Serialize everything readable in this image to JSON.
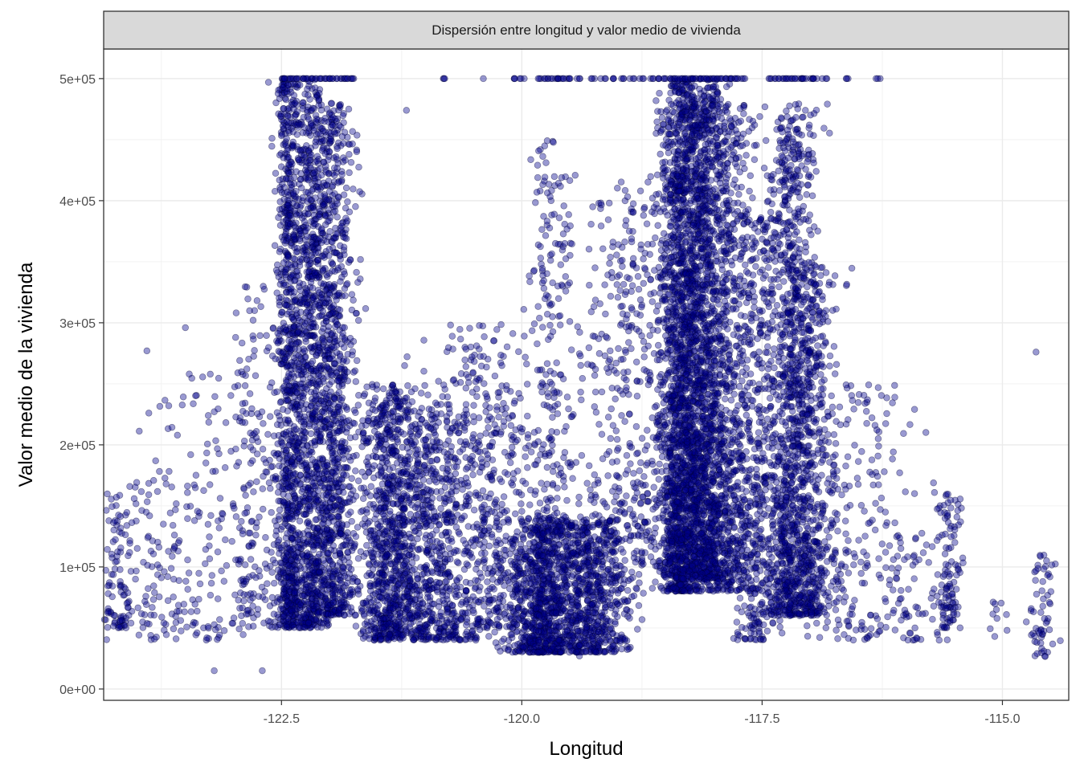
{
  "chart_data": {
    "type": "scatter",
    "facet_title": "Dispersión entre longitud y valor medio de vivienda",
    "xlabel": "Longitud",
    "ylabel": "Valor medio de la vivienda",
    "xlim": [
      -124.35,
      -114.31
    ],
    "ylim": [
      14999,
      500001
    ],
    "x_ticks": [
      -122.5,
      -120.0,
      -117.5,
      -115.0
    ],
    "x_tick_labels": [
      "-122.5",
      "-120.0",
      "-117.5",
      "-115.0"
    ],
    "y_ticks": [
      0,
      100000,
      200000,
      300000,
      400000,
      500000
    ],
    "y_tick_labels": [
      "0e+00",
      "1e+05",
      "2e+05",
      "3e+05",
      "4e+05",
      "5e+05"
    ],
    "grid": true,
    "legend": "none",
    "point_fill": "#00008B",
    "point_alpha": 0.4,
    "clusters": [
      {
        "x_center": -124.2,
        "x_spread": 0.12,
        "y_min": 50000,
        "y_max": 160000,
        "count": 90
      },
      {
        "x_center": -123.8,
        "x_spread": 0.25,
        "y_min": 40000,
        "y_max": 180000,
        "count": 110
      },
      {
        "x_center": -123.2,
        "x_spread": 0.3,
        "y_min": 40000,
        "y_max": 260000,
        "count": 150
      },
      {
        "x_center": -122.75,
        "x_spread": 0.15,
        "y_min": 50000,
        "y_max": 330000,
        "count": 160
      },
      {
        "x_center": -122.42,
        "x_spread": 0.07,
        "y_min": 50000,
        "y_max": 500001,
        "count": 900
      },
      {
        "x_center": -122.2,
        "x_spread": 0.09,
        "y_min": 50000,
        "y_max": 500001,
        "count": 900
      },
      {
        "x_center": -121.95,
        "x_spread": 0.11,
        "y_min": 60000,
        "y_max": 480000,
        "count": 1000
      },
      {
        "x_center": -121.4,
        "x_spread": 0.15,
        "y_min": 40000,
        "y_max": 250000,
        "count": 800
      },
      {
        "x_center": -121.0,
        "x_spread": 0.2,
        "y_min": 40000,
        "y_max": 230000,
        "count": 600
      },
      {
        "x_center": -120.6,
        "x_spread": 0.25,
        "y_min": 40000,
        "y_max": 300000,
        "count": 400
      },
      {
        "x_center": -120.2,
        "x_spread": 0.2,
        "y_min": 50000,
        "y_max": 250000,
        "count": 300
      },
      {
        "x_center": -119.8,
        "x_spread": 0.15,
        "y_min": 30000,
        "y_max": 140000,
        "count": 700
      },
      {
        "x_center": -119.3,
        "x_spread": 0.2,
        "y_min": 30000,
        "y_max": 140000,
        "count": 700
      },
      {
        "x_center": -119.7,
        "x_spread": 0.12,
        "y_min": 100000,
        "y_max": 450000,
        "count": 250
      },
      {
        "x_center": -119.05,
        "x_spread": 0.2,
        "y_min": 80000,
        "y_max": 400000,
        "count": 300
      },
      {
        "x_center": -118.6,
        "x_spread": 0.2,
        "y_min": 100000,
        "y_max": 420000,
        "count": 300
      },
      {
        "x_center": -118.35,
        "x_spread": 0.1,
        "y_min": 80000,
        "y_max": 500001,
        "count": 1600
      },
      {
        "x_center": -118.1,
        "x_spread": 0.12,
        "y_min": 90000,
        "y_max": 500001,
        "count": 1500
      },
      {
        "x_center": -117.85,
        "x_spread": 0.15,
        "y_min": 80000,
        "y_max": 480000,
        "count": 800
      },
      {
        "x_center": -117.55,
        "x_spread": 0.12,
        "y_min": 40000,
        "y_max": 400000,
        "count": 400
      },
      {
        "x_center": -117.2,
        "x_spread": 0.14,
        "y_min": 60000,
        "y_max": 480000,
        "count": 1000
      },
      {
        "x_center": -117.0,
        "x_spread": 0.15,
        "y_min": 60000,
        "y_max": 350000,
        "count": 600
      },
      {
        "x_center": -116.5,
        "x_spread": 0.3,
        "y_min": 40000,
        "y_max": 250000,
        "count": 200
      },
      {
        "x_center": -116.0,
        "x_spread": 0.25,
        "y_min": 40000,
        "y_max": 130000,
        "count": 80
      },
      {
        "x_center": -115.55,
        "x_spread": 0.06,
        "y_min": 50000,
        "y_max": 160000,
        "count": 100
      },
      {
        "x_center": -115.0,
        "x_spread": 0.1,
        "y_min": 40000,
        "y_max": 80000,
        "count": 10
      },
      {
        "x_center": -114.6,
        "x_spread": 0.08,
        "y_min": 25000,
        "y_max": 110000,
        "count": 60
      }
    ],
    "capped_points": {
      "y": 500001,
      "x": [
        -122.5,
        -122.45,
        -122.4,
        -122.35,
        -122.3,
        -122.25,
        -122.2,
        -122.15,
        -122.1,
        -122.05,
        -122.0,
        -121.95,
        -121.9,
        -121.85,
        -121.8,
        -121.75,
        -120.8,
        -120.1,
        -120.0,
        -119.8,
        -119.75,
        -119.7,
        -119.65,
        -119.6,
        -119.55,
        -119.5,
        -119.4,
        -119.25,
        -119.15,
        -119.05,
        -118.95,
        -118.85,
        -118.75,
        -118.65,
        -118.55,
        -118.5,
        -118.45,
        -118.4,
        -118.35,
        -118.3,
        -118.25,
        -118.2,
        -118.15,
        -118.1,
        -118.05,
        -118.0,
        -117.95,
        -117.9,
        -117.85,
        -117.8,
        -117.75,
        -117.7,
        -117.4,
        -117.35,
        -117.3,
        -117.25,
        -117.2,
        -117.15,
        -117.1,
        -117.05,
        -117.0,
        -116.95,
        -116.85,
        -116.6,
        -116.3
      ]
    },
    "outliers": [
      {
        "x": -123.5,
        "y": 296000
      },
      {
        "x": -123.9,
        "y": 277000
      },
      {
        "x": -123.88,
        "y": 226000
      },
      {
        "x": -114.65,
        "y": 276000
      },
      {
        "x": -121.8,
        "y": 475000
      },
      {
        "x": -121.2,
        "y": 474000
      },
      {
        "x": -120.4,
        "y": 500001
      },
      {
        "x": -123.2,
        "y": 15000
      },
      {
        "x": -122.7,
        "y": 15000
      },
      {
        "x": -119.4,
        "y": 27000
      }
    ]
  }
}
